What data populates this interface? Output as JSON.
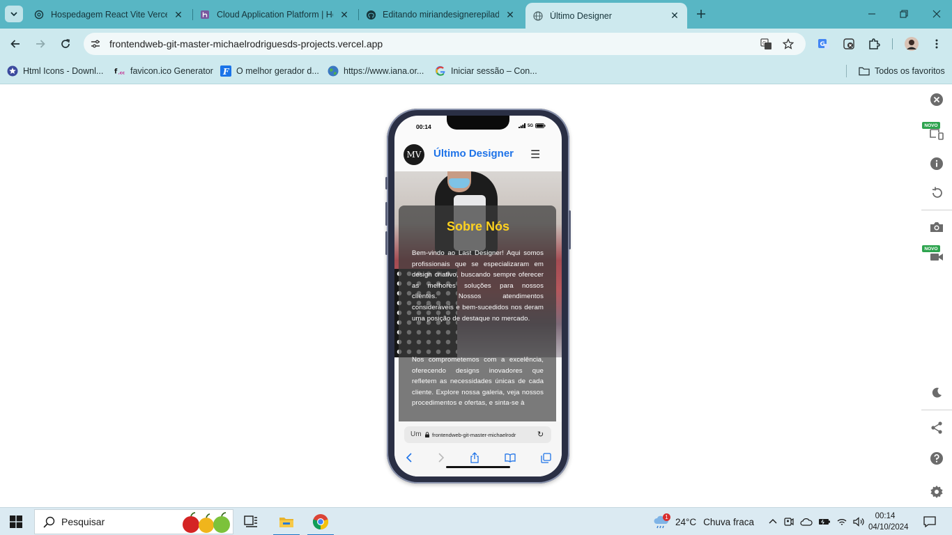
{
  "browser": {
    "tabs": [
      {
        "title": "Hospedagem React Vite Vercel",
        "icon": "chatgpt-icon"
      },
      {
        "title": "Cloud Application Platform | Her",
        "icon": "heroku-icon"
      },
      {
        "title": "Editando miriandesignerepilado",
        "icon": "github-icon"
      },
      {
        "title": "Último Designer",
        "icon": "globe-icon",
        "active": true
      }
    ],
    "url": "frontendweb-git-master-michaelrodriguesds-projects.vercel.app",
    "bookmarks": [
      {
        "label": "Html Icons - Downl...",
        "icon": "star-badge-icon"
      },
      {
        "label": "favicon.ico Generator",
        "icon": "favicon-icon"
      },
      {
        "label": "O melhor gerador d...",
        "icon": "f-logo-icon"
      },
      {
        "label": "https://www.iana.or...",
        "icon": "globe-icon"
      },
      {
        "label": "Iniciar sessão – Con...",
        "icon": "google-icon"
      }
    ],
    "all_bookmarks": "Todos os favoritos",
    "side_panel": {
      "novo_badge": "NOVO"
    }
  },
  "phone": {
    "status_time": "00:14",
    "status_network": "5G",
    "app": {
      "logo": "MV",
      "title": "Último Designer",
      "menu_icon": "☰"
    },
    "about": {
      "title": "Sobre Nós",
      "paragraph1": "Bem-vindo ao Last Designer! Aqui somos profissionais que se especializaram em design criativo, buscando sempre oferecer as melhores soluções para nossos clientes. Nossos atendimentos consideráveis e bem-sucedidos nos deram uma posição de destaque no mercado.",
      "paragraph2": "Nos comprometemos com a excelência, oferecendo designs inovadores que refletem as necessidades únicas de cada cliente. Explore nossa galeria, veja nossos procedimentos e ofertas, e sinta-se à"
    },
    "safari": {
      "peek_text": "Um",
      "url": "frontendweb-git-master-michaelrodr"
    }
  },
  "taskbar": {
    "search_placeholder": "Pesquisar",
    "weather_badge": "1",
    "temperature": "24°C",
    "weather": "Chuva fraca",
    "time": "00:14",
    "date": "04/10/2024"
  }
}
